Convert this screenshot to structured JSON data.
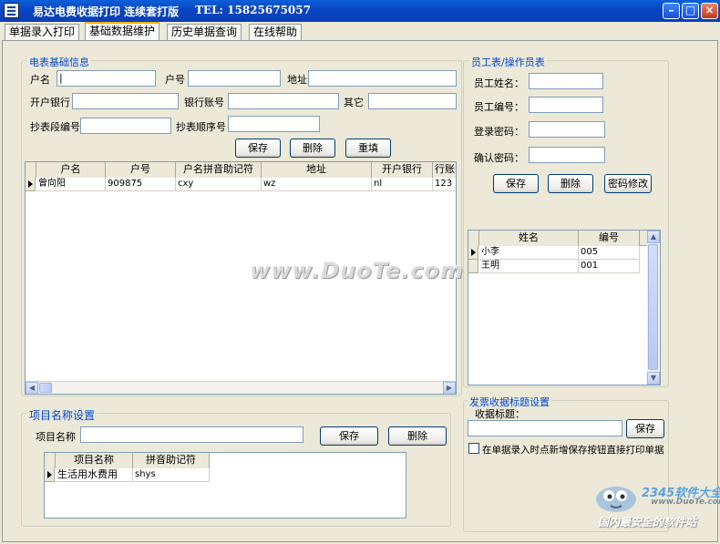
{
  "window": {
    "title": "易达电费收据打印 连续套打版",
    "phone": "TEL: 15825675057"
  },
  "tabs": [
    "单据录入打印",
    "基础数据维护",
    "历史单据查询",
    "在线帮助"
  ],
  "meter_info": {
    "title": "电表基础信息",
    "labels": {
      "name": "户名",
      "account_no": "户号",
      "address": "地址",
      "bank": "开户银行",
      "bank_account": "银行账号",
      "other": "其它",
      "segment_no": "抄表段编号",
      "sequence_no": "抄表顺序号"
    },
    "buttons": {
      "save": "保存",
      "delete": "删除",
      "refill": "重填"
    },
    "table": {
      "headers": [
        "户名",
        "户号",
        "户名拼音助记符",
        "地址",
        "开户银行",
        "行账"
      ],
      "rows": [
        [
          "曾向阳",
          "909875",
          "cxy",
          "wz",
          "nl",
          "123"
        ]
      ]
    }
  },
  "staff": {
    "title": "员工表/操作员表",
    "labels": {
      "name": "员工姓名：",
      "id": "员工编号：",
      "password": "登录密码：",
      "confirm": "确认密码："
    },
    "buttons": {
      "save": "保存",
      "delete": "删除",
      "change_pwd": "密码修改"
    },
    "table": {
      "headers": [
        "姓名",
        "编号"
      ],
      "rows": [
        [
          "小李",
          "005"
        ],
        [
          "王明",
          "001"
        ]
      ]
    }
  },
  "project": {
    "title": "项目名称设置",
    "label": "项目名称",
    "buttons": {
      "save": "保存",
      "delete": "删除"
    },
    "table": {
      "headers": [
        "项目名称",
        "拼音助记符"
      ],
      "rows": [
        [
          "生活用水费用",
          "shys"
        ]
      ]
    }
  },
  "receipt": {
    "title": "发票收据标题设置",
    "label": "收据标题：",
    "save": "保存",
    "checkbox": "在单据录入时点新增保存按钮直接打印单据"
  },
  "watermark": {
    "site": "www.DuoTe.com",
    "brand": "2345软件大全",
    "brand_url": "www.DuoTe.com",
    "slogan": "国内最安全的软件站"
  }
}
